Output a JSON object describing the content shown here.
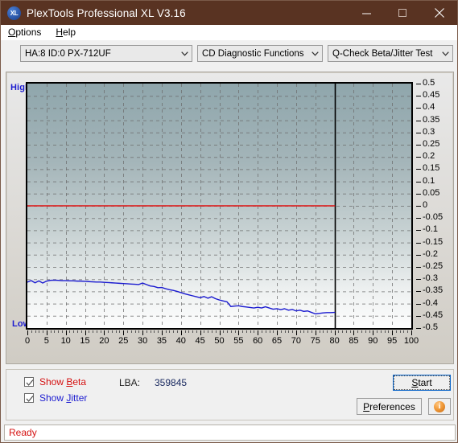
{
  "window": {
    "title": "PlexTools Professional XL V3.16",
    "icon": "xl-logo-icon",
    "minimize_label": "minimize-icon",
    "maximize_label": "maximize-icon",
    "close_label": "close-icon",
    "titlebar_color": "#593322"
  },
  "menubar": {
    "items": [
      {
        "name": "options",
        "label": "Options",
        "accel": "O"
      },
      {
        "name": "help",
        "label": "Help",
        "accel": "H"
      }
    ]
  },
  "toolbar": {
    "drive_select": {
      "value": "HA:8 ID:0  PX-712UF",
      "name": "drive-select"
    },
    "function_select": {
      "value": "CD Diagnostic Functions",
      "name": "function-select"
    },
    "test_select": {
      "value": "Q-Check Beta/Jitter Test",
      "name": "test-select"
    }
  },
  "chart_labels": {
    "high": "High",
    "low": "Low"
  },
  "bottom": {
    "show_beta": {
      "label": "Show Beta",
      "checked": true,
      "color": "#d51212"
    },
    "show_jitter": {
      "label": "Show Jitter",
      "checked": true,
      "color": "#1b1bd0"
    },
    "lba_label": "LBA:",
    "lba_value": "359845",
    "start_button": "Start",
    "preferences_button": "Preferences",
    "info_button": "i"
  },
  "statusbar": {
    "text": "Ready"
  },
  "chart_data": {
    "type": "line",
    "title": "Q-Check Beta/Jitter Test",
    "xlabel": "",
    "ylabel": "",
    "xlim": [
      0,
      100
    ],
    "ylim": [
      -0.5,
      0.5
    ],
    "grid": true,
    "legend": "none",
    "xticks": [
      0,
      5,
      10,
      15,
      20,
      25,
      30,
      35,
      40,
      45,
      50,
      55,
      60,
      65,
      70,
      75,
      80,
      85,
      90,
      95,
      100
    ],
    "yticks": [
      0.5,
      0.45,
      0.4,
      0.35,
      0.3,
      0.25,
      0.2,
      0.15,
      0.1,
      0.05,
      0,
      -0.05,
      -0.1,
      -0.15,
      -0.2,
      -0.25,
      -0.3,
      -0.35,
      -0.4,
      -0.45,
      -0.5
    ],
    "data_end_x": 80,
    "series": [
      {
        "name": "Beta",
        "color": "#e01010",
        "x": [
          0,
          80
        ],
        "y": [
          0.0,
          0.0
        ]
      },
      {
        "name": "Jitter",
        "color": "#1b1bd0",
        "x": [
          0,
          1,
          2,
          3,
          4,
          5,
          6,
          7,
          8,
          9,
          10,
          11,
          12,
          13,
          14,
          15,
          16,
          17,
          18,
          19,
          20,
          21,
          22,
          23,
          24,
          25,
          26,
          27,
          28,
          29,
          30,
          31,
          32,
          33,
          34,
          35,
          36,
          37,
          38,
          39,
          40,
          41,
          42,
          43,
          44,
          45,
          46,
          47,
          48,
          49,
          50,
          51,
          52,
          53,
          54,
          55,
          56,
          57,
          58,
          59,
          60,
          61,
          62,
          63,
          64,
          65,
          66,
          67,
          68,
          69,
          70,
          71,
          72,
          73,
          74,
          75,
          76,
          77,
          78,
          79,
          80
        ],
        "y": [
          -0.312,
          -0.306,
          -0.315,
          -0.307,
          -0.316,
          -0.308,
          -0.305,
          -0.304,
          -0.305,
          -0.306,
          -0.306,
          -0.307,
          -0.307,
          -0.308,
          -0.308,
          -0.309,
          -0.31,
          -0.311,
          -0.312,
          -0.312,
          -0.313,
          -0.314,
          -0.315,
          -0.316,
          -0.317,
          -0.318,
          -0.319,
          -0.32,
          -0.321,
          -0.322,
          -0.316,
          -0.322,
          -0.328,
          -0.33,
          -0.335,
          -0.334,
          -0.339,
          -0.343,
          -0.346,
          -0.35,
          -0.355,
          -0.36,
          -0.364,
          -0.368,
          -0.372,
          -0.376,
          -0.371,
          -0.378,
          -0.372,
          -0.38,
          -0.385,
          -0.389,
          -0.393,
          -0.412,
          -0.41,
          -0.409,
          -0.412,
          -0.414,
          -0.416,
          -0.418,
          -0.415,
          -0.418,
          -0.413,
          -0.418,
          -0.423,
          -0.421,
          -0.425,
          -0.421,
          -0.427,
          -0.424,
          -0.43,
          -0.427,
          -0.432,
          -0.43,
          -0.436,
          -0.442,
          -0.44,
          -0.438,
          -0.437,
          -0.437,
          -0.436
        ]
      }
    ]
  }
}
